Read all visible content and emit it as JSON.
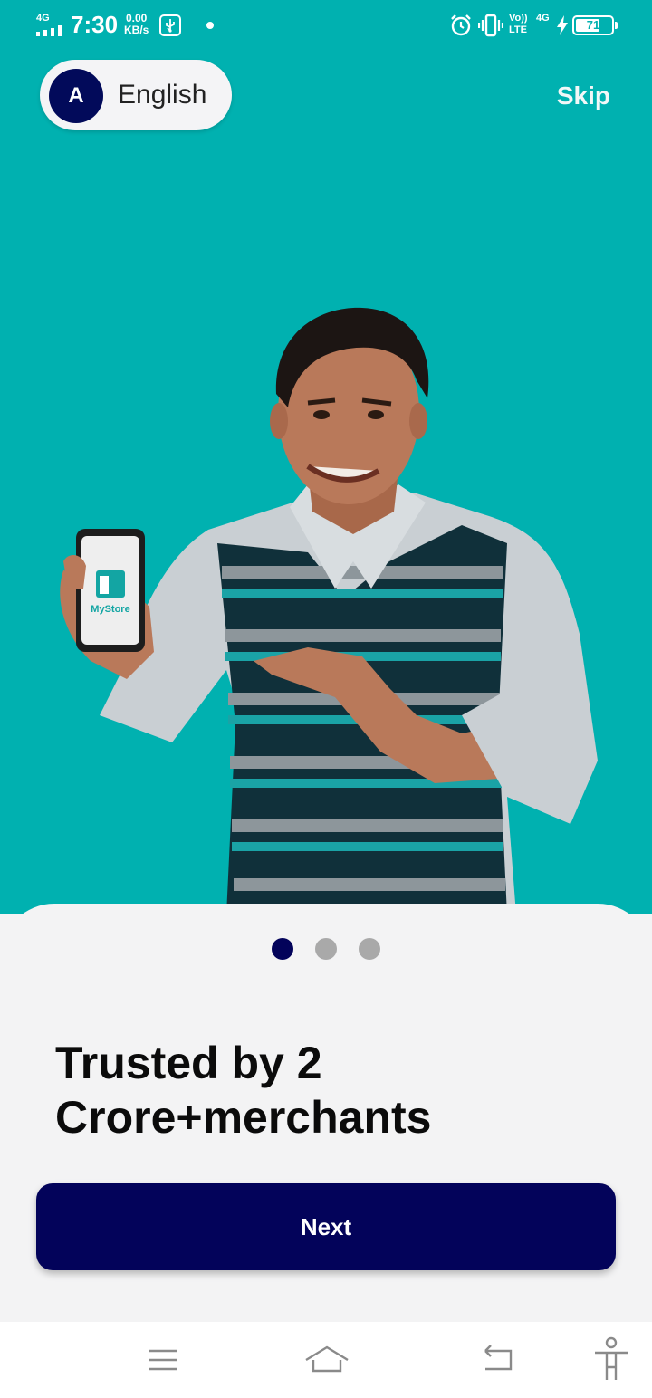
{
  "status_bar": {
    "network": "4G",
    "time": "7:30",
    "speed_value": "0.00",
    "speed_unit": "KB/s",
    "volte_top": "Vo))",
    "volte_bottom": "LTE",
    "network_right": "4G",
    "battery": "71",
    "battery_level": 0.71,
    "icons": [
      "signal-icon",
      "usb-icon",
      "notification-dot-icon",
      "alarm-icon",
      "vibrate-icon",
      "volte-icon",
      "charging-icon",
      "battery-icon"
    ]
  },
  "header": {
    "language_initial": "A",
    "language_label": "English",
    "skip_label": "Skip"
  },
  "illustration": {
    "phone_app_label": "MyStore"
  },
  "carousel": {
    "dots": [
      {
        "active": true,
        "color": "#03035a"
      },
      {
        "active": false,
        "color": "#a9a9a9"
      },
      {
        "active": false,
        "color": "#a9a9a9"
      }
    ]
  },
  "content": {
    "headline": "Trusted by 2 Crore+merchants",
    "next_label": "Next"
  },
  "navbar": {
    "icons": [
      "menu-icon",
      "home-icon",
      "back-icon",
      "accessibility-icon"
    ]
  },
  "colors": {
    "hero_background": "#00b1b0",
    "primary": "#03035a",
    "sheet_background": "#f3f3f4"
  }
}
